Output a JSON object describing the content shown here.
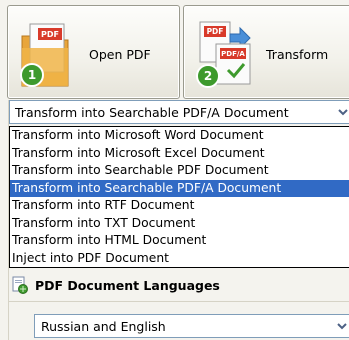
{
  "toolbar": {
    "open_pdf_label": "Open PDF",
    "transform_label": "Transform",
    "open_badge": "1",
    "transform_badge": "2"
  },
  "transform_combo": {
    "selected": "Transform into Searchable PDF/A Document",
    "options": [
      "Transform into Microsoft Word Document",
      "Transform into Microsoft Excel Document",
      "Transform into Searchable PDF Document",
      "Transform into Searchable PDF/A Document",
      "Transform into RTF Document",
      "Transform into TXT Document",
      "Transform into HTML Document",
      "Inject into PDF Document"
    ],
    "highlighted_index": 3
  },
  "languages_section": {
    "title": "PDF Document Languages",
    "selected_language": "Russian and English"
  },
  "colors": {
    "selection": "#316ac5",
    "badge_green": "#3e9a2d",
    "pdf_red": "#d83a2a"
  }
}
